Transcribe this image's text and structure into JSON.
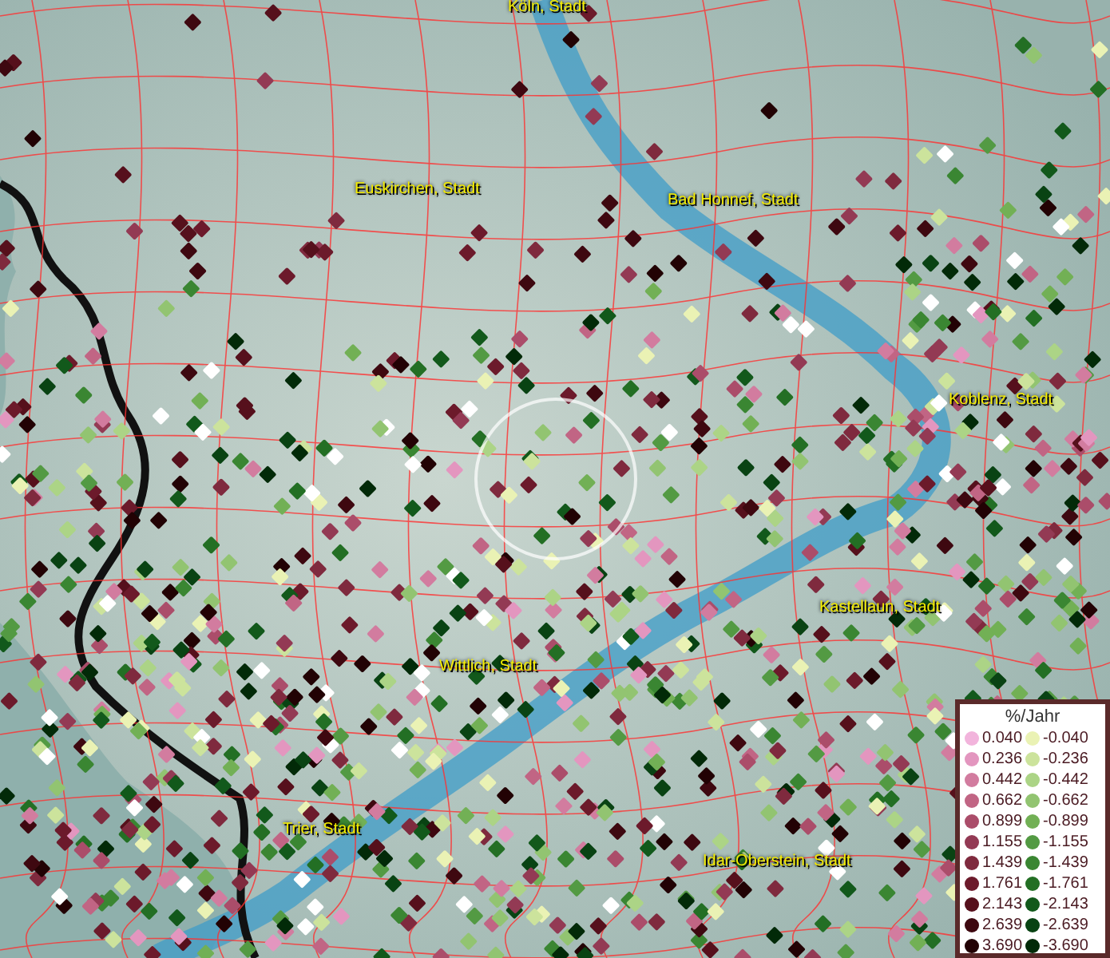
{
  "map": {
    "places": [
      {
        "label": "Köln, Stadt"
      },
      {
        "label": "Euskirchen, Stadt"
      },
      {
        "label": "Bad Honnef, Stadt"
      },
      {
        "label": "Koblenz, Stadt"
      },
      {
        "label": "Kastellaun, Stadt"
      },
      {
        "label": "Wittlich, Stadt"
      },
      {
        "label": "Trier, Stadt"
      },
      {
        "label": "Idar-Oberstein, Stadt"
      }
    ]
  },
  "legend": {
    "title": "%/Jahr",
    "columns": [
      [
        {
          "value": "0.040",
          "color": "#f2b4dc"
        },
        {
          "value": "0.236",
          "color": "#e396bf"
        },
        {
          "value": "0.442",
          "color": "#d27c9f"
        },
        {
          "value": "0.662",
          "color": "#c16584"
        },
        {
          "value": "0.899",
          "color": "#ab4d6a"
        },
        {
          "value": "1.155",
          "color": "#933a54"
        },
        {
          "value": "1.439",
          "color": "#7f2a3e"
        },
        {
          "value": "1.761",
          "color": "#6c1a2b"
        },
        {
          "value": "2.143",
          "color": "#56101c"
        },
        {
          "value": "2.639",
          "color": "#3e0810"
        },
        {
          "value": "3.690",
          "color": "#220204"
        }
      ],
      [
        {
          "value": "-0.040",
          "color": "#eaf2b4"
        },
        {
          "value": "-0.236",
          "color": "#cce39c"
        },
        {
          "value": "-0.442",
          "color": "#acd486"
        },
        {
          "value": "-0.662",
          "color": "#92c471"
        },
        {
          "value": "-0.899",
          "color": "#72b055"
        },
        {
          "value": "-1.155",
          "color": "#539a43"
        },
        {
          "value": "-1.439",
          "color": "#3a8632"
        },
        {
          "value": "-1.761",
          "color": "#236f24"
        },
        {
          "value": "-2.143",
          "color": "#12591b"
        },
        {
          "value": "-2.639",
          "color": "#094313"
        },
        {
          "value": "-3.690",
          "color": "#022a08"
        }
      ]
    ]
  }
}
